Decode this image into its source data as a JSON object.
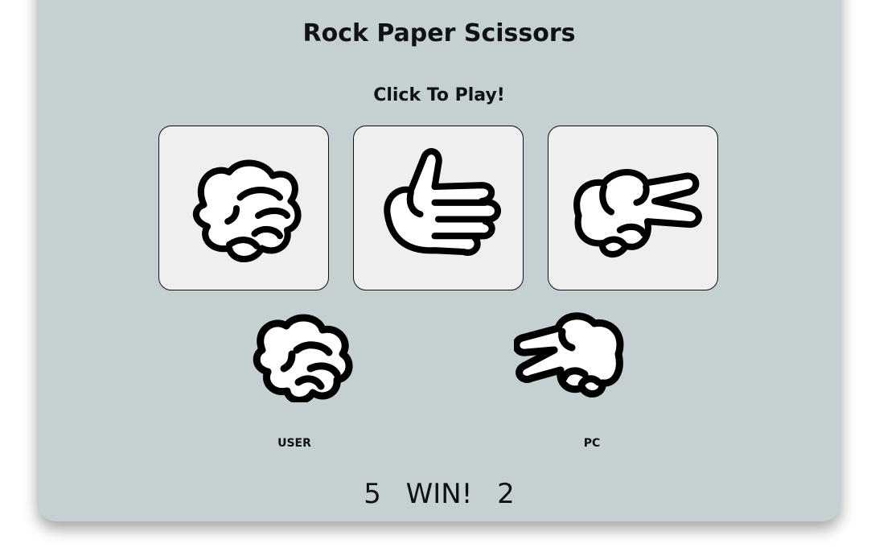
{
  "game": {
    "title": "Rock Paper Scissors",
    "prompt": "Click To Play!"
  },
  "choices": [
    {
      "name": "rock",
      "icon": "rock-hand-icon"
    },
    {
      "name": "paper",
      "icon": "paper-hand-icon"
    },
    {
      "name": "scissors",
      "icon": "scissors-hand-icon"
    }
  ],
  "players": {
    "user_label": "USER",
    "pc_label": "PC",
    "user_choice_icon": "rock-hand-icon",
    "pc_choice_icon": "scissors-hand-icon"
  },
  "score": {
    "user": "5",
    "result": "WIN!",
    "pc": "2"
  },
  "colors": {
    "background": "#c4d0d1",
    "card": "#efefef"
  }
}
